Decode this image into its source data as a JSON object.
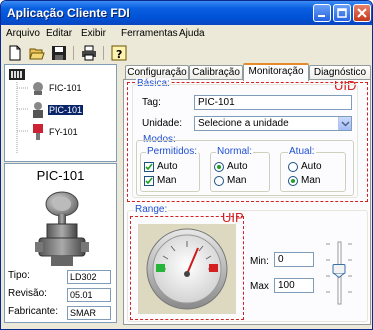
{
  "window": {
    "title": "Aplicação Cliente FDI"
  },
  "menu": [
    "Arquivo",
    "Editar",
    "Exibir",
    "Ferramentas",
    "Ajuda"
  ],
  "toolbar": {
    "icons": [
      "new-file-icon",
      "open-folder-icon",
      "save-icon",
      "print-icon",
      "help-icon"
    ]
  },
  "tree": {
    "items": [
      "FIC-101",
      "PIC-101",
      "FY-101"
    ],
    "selected": "PIC-101"
  },
  "device": {
    "name": "PIC-101",
    "fields": [
      {
        "label": "Tipo:",
        "value": "LD302"
      },
      {
        "label": "Revisão:",
        "value": "05.01"
      },
      {
        "label": "Fabricante:",
        "value": "SMAR"
      }
    ]
  },
  "tabs": [
    "Configuração",
    "Calibração",
    "Monitoração",
    "Diagnóstico"
  ],
  "active_tab": "Monitoração",
  "uid": {
    "label": "UID",
    "basic_title": "Básica:",
    "tag_label": "Tag:",
    "tag_value": "PIC-101",
    "unit_label": "Unidade:",
    "unit_value": "Selecione a unidade",
    "modes_title": "Modos:",
    "permitted": {
      "title": "Permitidos:",
      "options": [
        "Auto",
        "Man"
      ],
      "checked": [
        true,
        true
      ]
    },
    "normal": {
      "title": "Normal:",
      "options": [
        "Auto",
        "Man"
      ],
      "selected": "Auto"
    },
    "atual": {
      "title": "Atual:",
      "options": [
        "Auto",
        "Man"
      ],
      "selected": "Man"
    }
  },
  "range": {
    "title": "Range:",
    "uip_label": "UIP",
    "min_label": "Min:",
    "min_value": "0",
    "max_label": "Max",
    "max_value": "100",
    "slider_level": 0.55
  },
  "colors": {
    "accent_red": "#d32020",
    "group_blue": "#1f4fd1",
    "title_blue": "#0052d6"
  }
}
